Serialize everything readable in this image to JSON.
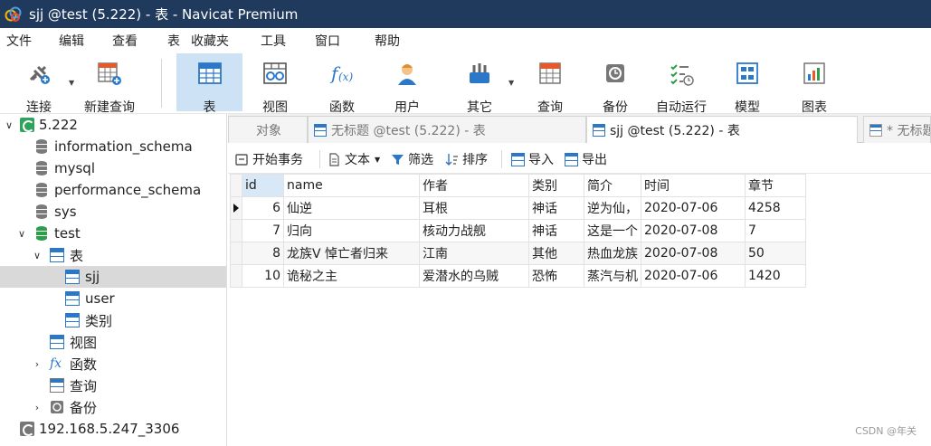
{
  "window": {
    "title": "sjj @test (5.222) - 表 - Navicat Premium"
  },
  "menu": [
    "文件",
    "编辑",
    "查看",
    "表",
    "收藏夹",
    "工具",
    "窗口",
    "帮助"
  ],
  "toolbar": {
    "buttons": [
      "连接",
      "新建查询",
      "表",
      "视图",
      "函数",
      "用户",
      "其它",
      "查询",
      "备份",
      "自动运行",
      "模型",
      "图表"
    ],
    "active": "表"
  },
  "navigator": {
    "items": [
      "5.222",
      "information_schema",
      "mysql",
      "performance_schema",
      "sys",
      "test",
      "表",
      "sjj",
      "user",
      "类别",
      "视图",
      "函数",
      "查询",
      "备份",
      "192.168.5.247_3306"
    ],
    "selected": "sjj"
  },
  "tabs": [
    "对象",
    "无标题 @test (5.222) - 表",
    "sjj @test (5.222) - 表",
    "* 无标题"
  ],
  "subtoolbar": [
    "开始事务",
    "文本",
    "筛选",
    "排序",
    "导入",
    "导出"
  ],
  "grid": {
    "columns": [
      "id",
      "name",
      "作者",
      "类别",
      "简介",
      "时间",
      "章节"
    ],
    "rows": [
      [
        "6",
        "仙逆",
        "耳根",
        "神话",
        "逆为仙，",
        "2020-07-06",
        "4258"
      ],
      [
        "7",
        "归向",
        "核动力战舰",
        "神话",
        "这是一个",
        "2020-07-08",
        "7"
      ],
      [
        "8",
        "龙族V 悼亡者归来",
        "江南",
        "其他",
        "热血龙族",
        "2020-07-08",
        "50"
      ],
      [
        "10",
        "诡秘之主",
        "爱潜水的乌贼",
        "恐怖",
        "蒸汽与机",
        "2020-07-06",
        "1420"
      ]
    ]
  },
  "watermark": "CSDN @年关",
  "colors": {
    "titlebar": "#1f3a5c",
    "active_button": "#cde3f5",
    "selection": "#d9d9d9",
    "accent": "#2c78c8"
  }
}
